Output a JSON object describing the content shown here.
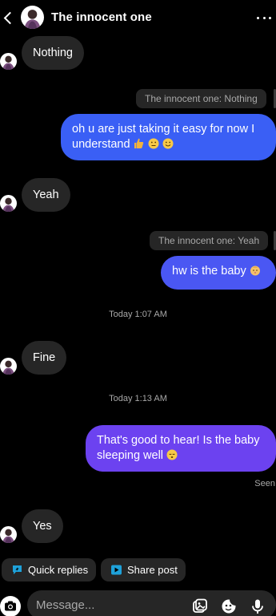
{
  "header": {
    "title": "The innocent one",
    "back_icon": "chevron-left-icon",
    "more_icon": "more-dots-icon"
  },
  "messages": {
    "m1": "Nothing",
    "q1": "The innocent one: Nothing",
    "m2": "oh u are just taking it easy for now   I understand",
    "m3": "Yeah",
    "q2": "The innocent one: Yeah",
    "m4": "hw is the baby",
    "ts1": "Today 1:07 AM",
    "m5": "Fine",
    "ts2": "Today 1:13 AM",
    "m6": "That's good to hear! Is the baby sleeping well",
    "seen": "Seen",
    "m7": "Yes"
  },
  "quick": {
    "replies": "Quick replies",
    "share": "Share post"
  },
  "composer": {
    "placeholder": "Message..."
  },
  "colors": {
    "incoming": "#262626",
    "outgoing_blue": "#3a5ff5",
    "outgoing_purple": "#6c42f0",
    "quick_reply_accent": "#1ea1d9"
  }
}
